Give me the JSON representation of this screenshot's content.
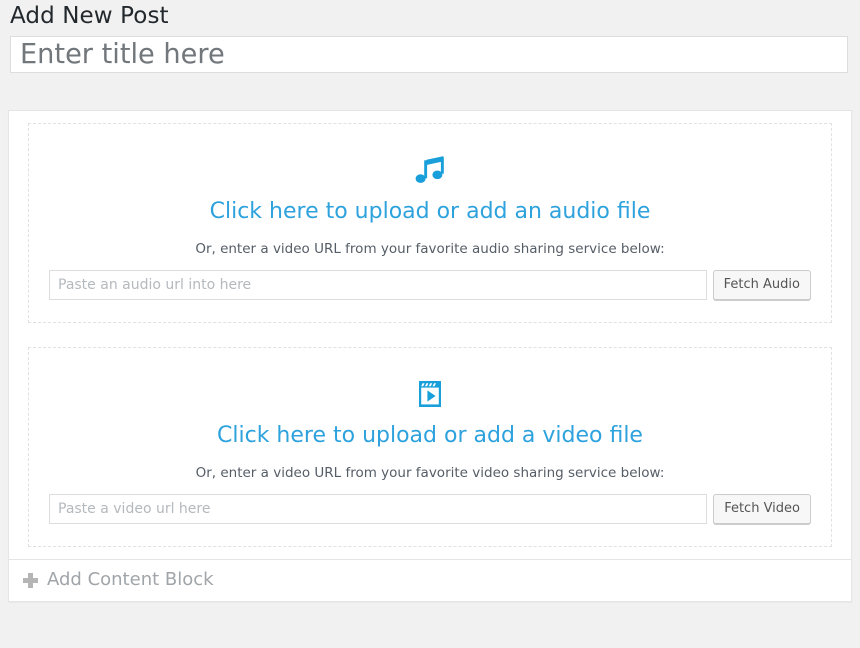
{
  "page": {
    "title": "Add New Post",
    "background_color": "#f1f1f1",
    "accent_color": "#2ea2dd"
  },
  "title_field": {
    "value": "",
    "placeholder": "Enter title here"
  },
  "blocks": [
    {
      "type": "audio",
      "icon": "music-note-icon",
      "cta": "Click here to upload or add an audio file",
      "hint": "Or, enter a video URL from your favorite audio sharing service below:",
      "url_field": {
        "value": "",
        "placeholder": "Paste an audio url into here"
      },
      "fetch_button": "Fetch Audio"
    },
    {
      "type": "video",
      "icon": "video-film-icon",
      "cta": "Click here to upload or add a video file",
      "hint": "Or, enter a video URL from your favorite video sharing service below:",
      "url_field": {
        "value": "",
        "placeholder": "Paste a video url here"
      },
      "fetch_button": "Fetch Video"
    }
  ],
  "footer": {
    "add_block_label": "Add Content Block",
    "add_block_icon": "plus-icon"
  }
}
